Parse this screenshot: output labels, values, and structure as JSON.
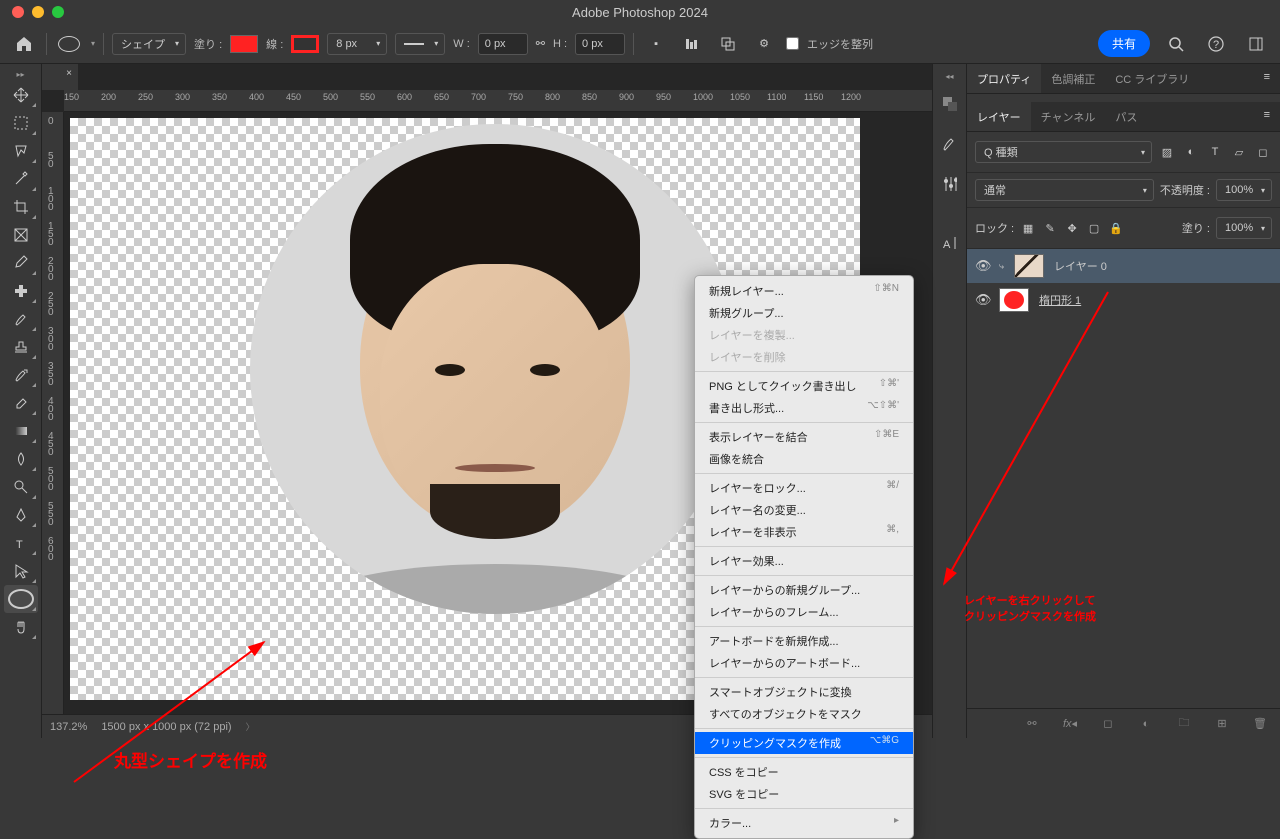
{
  "title": "Adobe Photoshop 2024",
  "toolbar": {
    "shape_mode": "シェイプ",
    "fill_label": "塗り :",
    "stroke_label": "線 :",
    "stroke_width": "8 px",
    "w_label": "W :",
    "w_value": "0 px",
    "h_label": "H :",
    "h_value": "0 px",
    "edge_align": "エッジを整列",
    "share": "共有",
    "fill_color": "#ff2222",
    "stroke_color": "#ff2222"
  },
  "status": {
    "zoom": "137.2%",
    "doc_info": "1500 px x 1000 px (72 ppi)"
  },
  "ruler_h": [
    "150",
    "200",
    "250",
    "300",
    "350",
    "400",
    "450",
    "500",
    "550",
    "600",
    "650",
    "700",
    "750",
    "800",
    "850",
    "900",
    "950",
    "1000",
    "1050",
    "1100",
    "1150",
    "1200"
  ],
  "ruler_v": [
    "0",
    "50",
    "100",
    "150",
    "200",
    "250",
    "300",
    "350",
    "400",
    "450",
    "500",
    "550",
    "600"
  ],
  "panels": {
    "top_tabs": [
      "プロパティ",
      "色調補正",
      "CC ライブラリ"
    ],
    "layers_tabs": [
      "レイヤー",
      "チャンネル",
      "パス"
    ],
    "filter_label": "Q 種類",
    "blend_mode": "通常",
    "opacity_label": "不透明度 :",
    "opacity_value": "100%",
    "lock_label": "ロック :",
    "fill_label": "塗り :",
    "fill_value": "100%",
    "layers": {
      "l0": "レイヤー 0",
      "l1": "楕円形 1"
    }
  },
  "context_menu": {
    "items": [
      {
        "label": "新規レイヤー...",
        "shortcut": "⇧⌘N"
      },
      {
        "label": "新規グループ..."
      },
      {
        "label": "レイヤーを複製...",
        "disabled": true
      },
      {
        "label": "レイヤーを削除",
        "disabled": true
      },
      {
        "sep": true
      },
      {
        "label": "PNG としてクイック書き出し",
        "shortcut": "⇧⌘'"
      },
      {
        "label": "書き出し形式...",
        "shortcut": "⌥⇧⌘'"
      },
      {
        "sep": true
      },
      {
        "label": "表示レイヤーを結合",
        "shortcut": "⇧⌘E"
      },
      {
        "label": "画像を統合"
      },
      {
        "sep": true
      },
      {
        "label": "レイヤーをロック...",
        "shortcut": "⌘/"
      },
      {
        "label": "レイヤー名の変更..."
      },
      {
        "label": "レイヤーを非表示",
        "shortcut": "⌘,"
      },
      {
        "sep": true
      },
      {
        "label": "レイヤー効果..."
      },
      {
        "sep": true
      },
      {
        "label": "レイヤーからの新規グループ..."
      },
      {
        "label": "レイヤーからのフレーム..."
      },
      {
        "sep": true
      },
      {
        "label": "アートボードを新規作成..."
      },
      {
        "label": "レイヤーからのアートボード..."
      },
      {
        "sep": true
      },
      {
        "label": "スマートオブジェクトに変換"
      },
      {
        "label": "すべてのオブジェクトをマスク"
      },
      {
        "sep": true
      },
      {
        "label": "クリッピングマスクを作成",
        "shortcut": "⌥⌘G",
        "selected": true
      },
      {
        "sep": true
      },
      {
        "label": "CSS をコピー"
      },
      {
        "label": "SVG をコピー"
      },
      {
        "sep": true
      },
      {
        "label": "カラー...",
        "submenu": true
      }
    ]
  },
  "annotations": {
    "a1": "丸型シェイプを作成",
    "a2_l1": "レイヤーを右クリックして",
    "a2_l2": "クリッピングマスクを作成"
  }
}
